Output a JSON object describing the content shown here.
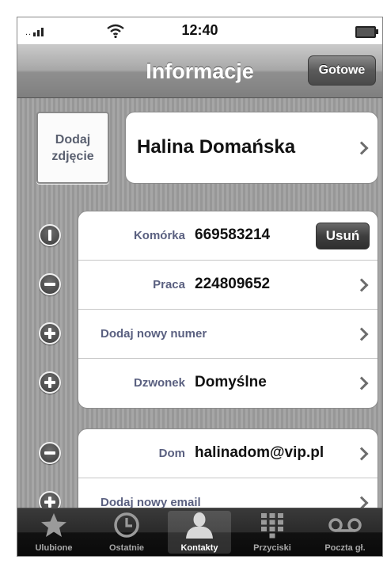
{
  "status_bar": {
    "time": "12:40"
  },
  "nav": {
    "title": "Informacje",
    "done_label": "Gotowe"
  },
  "photo": {
    "label": "Dodaj zdjęcie"
  },
  "contact": {
    "name": "Halina Domańska"
  },
  "phones": [
    {
      "label": "Komórka",
      "value": "669583214",
      "control": "remove-active",
      "delete_label": "Usuń"
    },
    {
      "label": "Praca",
      "value": "224809652",
      "control": "remove"
    }
  ],
  "add_phone": {
    "label": "Dodaj nowy numer"
  },
  "ringtone": {
    "label": "Dzwonek",
    "value": "Domyślne"
  },
  "emails": [
    {
      "label": "Dom",
      "value": "halinadom@vip.pl"
    }
  ],
  "add_email": {
    "label": "Dodaj nowy email"
  },
  "tabs": [
    {
      "label": "Ulubione",
      "icon": "star-icon",
      "active": false
    },
    {
      "label": "Ostatnie",
      "icon": "clock-icon",
      "active": false
    },
    {
      "label": "Kontakty",
      "icon": "person-icon",
      "active": true
    },
    {
      "label": "Przyciski",
      "icon": "keypad-icon",
      "active": false
    },
    {
      "label": "Poczta gł.",
      "icon": "voicemail-icon",
      "active": false
    }
  ]
}
